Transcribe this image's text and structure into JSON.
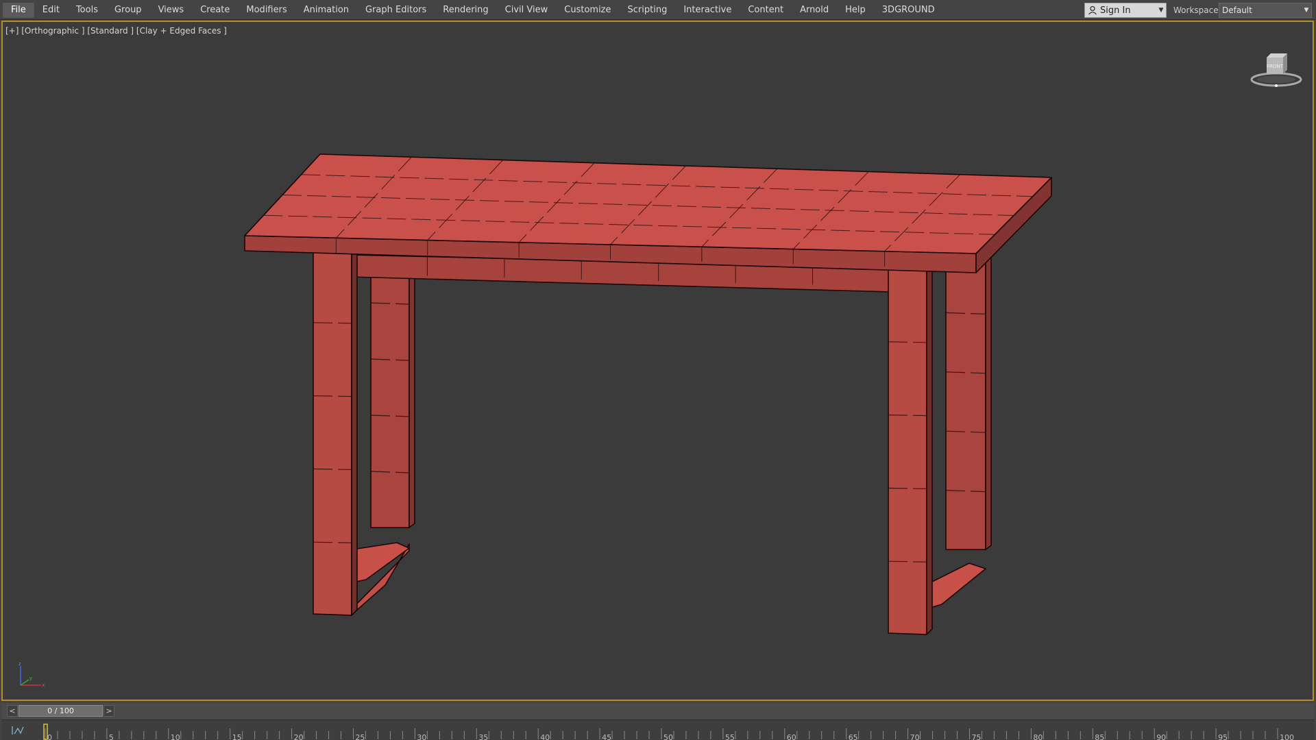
{
  "menubar": {
    "items": [
      {
        "label": "File",
        "name": "menu-file",
        "active": true
      },
      {
        "label": "Edit",
        "name": "menu-edit"
      },
      {
        "label": "Tools",
        "name": "menu-tools"
      },
      {
        "label": "Group",
        "name": "menu-group"
      },
      {
        "label": "Views",
        "name": "menu-views"
      },
      {
        "label": "Create",
        "name": "menu-create"
      },
      {
        "label": "Modifiers",
        "name": "menu-modifiers"
      },
      {
        "label": "Animation",
        "name": "menu-animation"
      },
      {
        "label": "Graph Editors",
        "name": "menu-graph-editors"
      },
      {
        "label": "Rendering",
        "name": "menu-rendering"
      },
      {
        "label": "Civil View",
        "name": "menu-civil-view"
      },
      {
        "label": "Customize",
        "name": "menu-customize"
      },
      {
        "label": "Scripting",
        "name": "menu-scripting"
      },
      {
        "label": "Interactive",
        "name": "menu-interactive"
      },
      {
        "label": "Content",
        "name": "menu-content"
      },
      {
        "label": "Arnold",
        "name": "menu-arnold"
      },
      {
        "label": "Help",
        "name": "menu-help"
      },
      {
        "label": "3DGROUND",
        "name": "menu-3dground"
      }
    ],
    "signin_label": "Sign In",
    "signin_icon": "user-icon",
    "workspaces_label": "Workspaces:",
    "workspaces_value": "Default"
  },
  "viewport": {
    "label": "[+] [Orthographic ] [Standard ] [Clay + Edged Faces ]",
    "viewcube_face": "FRONT",
    "model_color": "#b84a44",
    "edge_color": "#1a0606",
    "border_color": "#b58e2b"
  },
  "timeslider": {
    "prev": "<",
    "frame_display": "0 / 100",
    "next": ">"
  },
  "trackbar": {
    "ticks": [
      "0",
      "5",
      "10",
      "15",
      "20",
      "25",
      "30",
      "35",
      "40",
      "45",
      "50",
      "55",
      "60",
      "65",
      "70",
      "75",
      "80",
      "85",
      "90",
      "95",
      "100"
    ],
    "current_frame": 0
  }
}
